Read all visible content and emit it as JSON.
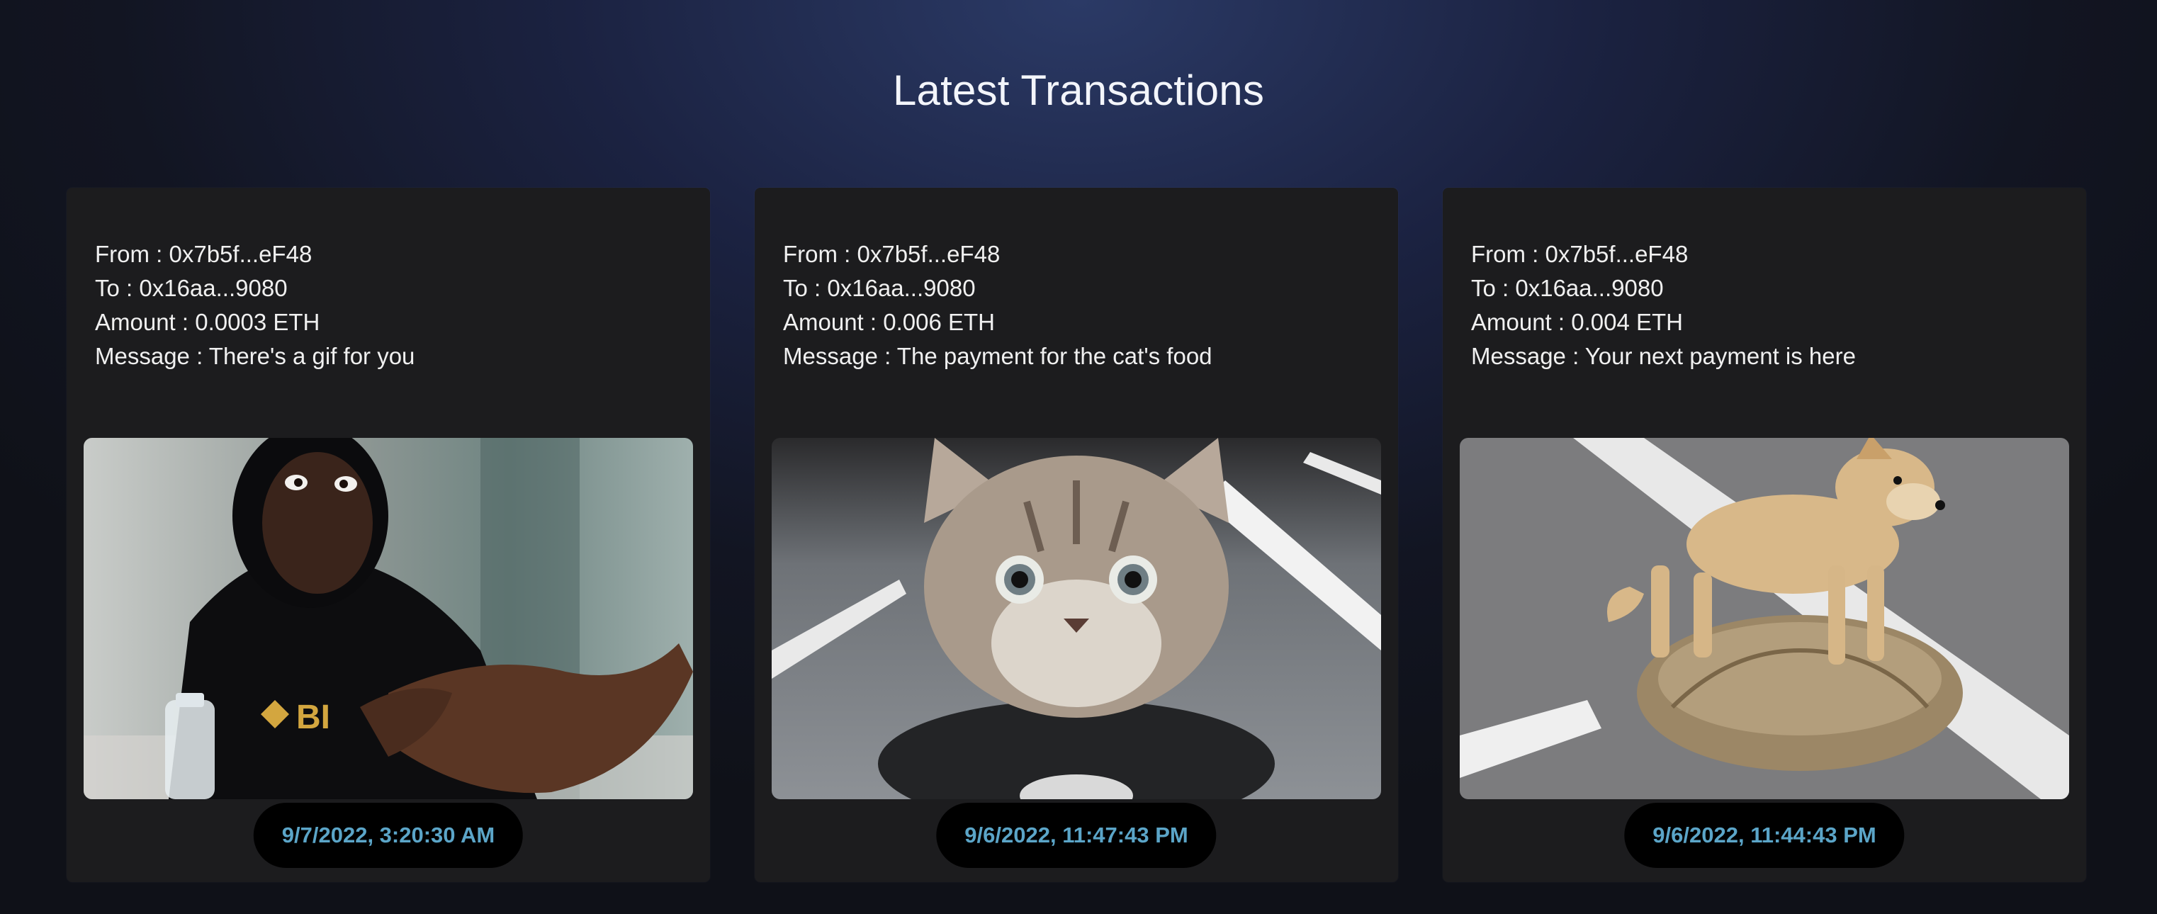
{
  "page": {
    "title": "Latest Transactions"
  },
  "transactions": [
    {
      "from": "From : 0x7b5f...eF48",
      "to": "To : 0x16aa...9080",
      "amount": "Amount : 0.0003 ETH",
      "message": "Message : There's a gif for you",
      "timestamp": "9/7/2022, 3:20:30 AM",
      "gif_subject": "man-shrugging-gif"
    },
    {
      "from": "From : 0x7b5f...eF48",
      "to": "To : 0x16aa...9080",
      "amount": "Amount : 0.006 ETH",
      "message": "Message : The payment for the cat's food",
      "timestamp": "9/6/2022, 11:47:43 PM",
      "gif_subject": "cat-riding-motorcycle-gif"
    },
    {
      "from": "From : 0x7b5f...eF48",
      "to": "To : 0x16aa...9080",
      "amount": "Amount : 0.004 ETH",
      "message": "Message : Your next payment is here",
      "timestamp": "9/6/2022, 11:44:43 PM",
      "gif_subject": "dog-riding-tortoise-gif"
    }
  ],
  "colors": {
    "background": "#121522",
    "card": "#1c1c1e",
    "timestamp_text": "#5ba5c8",
    "timestamp_pill": "#000000"
  }
}
